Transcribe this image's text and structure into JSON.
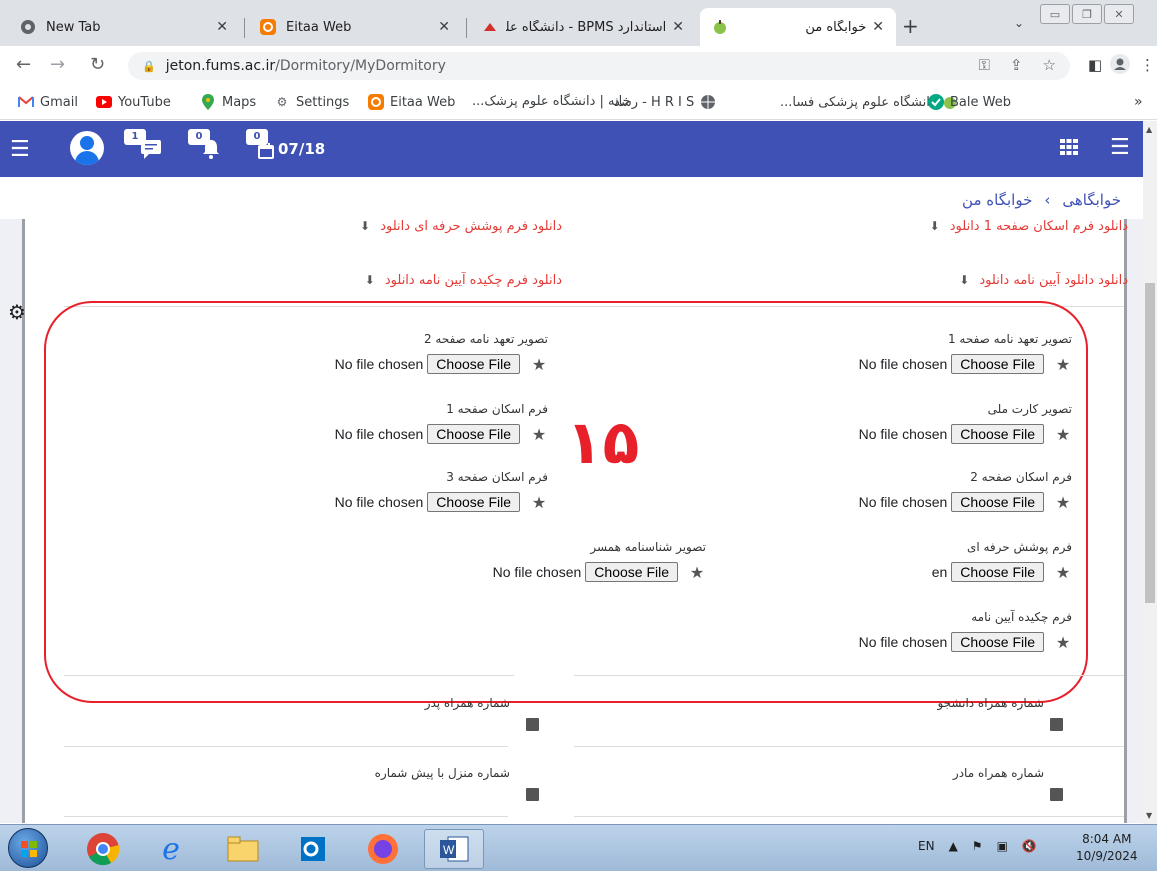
{
  "browser": {
    "tabs": [
      {
        "title": "New Tab",
        "favicon": "chrome-icon"
      },
      {
        "title": "Eitaa Web",
        "favicon": "eitaa-icon"
      },
      {
        "title": "استاندارد BPMS - دانشگاه علوم",
        "favicon": "bpms-icon"
      },
      {
        "title": "خوابگاه من",
        "favicon": "fums-icon",
        "active": true
      }
    ],
    "url_host": "jeton.fums.ac.ir",
    "url_path": "/Dormitory/MyDormitory",
    "bookmarks": [
      {
        "label": "Gmail",
        "icon": "gmail-icon"
      },
      {
        "label": "YouTube",
        "icon": "youtube-icon"
      },
      {
        "label": "Maps",
        "icon": "maps-icon"
      },
      {
        "label": "Settings",
        "icon": "gear-icon"
      },
      {
        "label": "Eitaa Web",
        "icon": "eitaa-icon"
      },
      {
        "label": "خانه | دانشگاه علوم پزشک...",
        "icon": "none"
      },
      {
        "label": "H R I S - رشد",
        "icon": "globe-icon"
      },
      {
        "label": "دانشگاه علوم پزشکی فسا...",
        "icon": "fums-icon"
      },
      {
        "label": "Bale Web",
        "icon": "bale-icon"
      }
    ]
  },
  "header": {
    "messages_badge": "1",
    "notifications_badge": "0",
    "calendar_badge": "0",
    "date": "07/18",
    "colors": {
      "bar": "#3f51b5"
    }
  },
  "breadcrumb": {
    "parent": "خوابگاهی",
    "current": "خوابگاه من",
    "separator": "›"
  },
  "downloads": {
    "top_right": "دانلود فرم اسکان صفحه 1",
    "top_left": "دانلود فرم پوشش حرفه ای",
    "mid_right": "دانلود دانلود آیین نامه",
    "mid_left": "دانلود فرم چکیده آیین نامه",
    "link_text": "دانلود"
  },
  "uploads": {
    "no_file_text": "No file chosen",
    "choose_label": "Choose File",
    "truncated_no_file": "en",
    "fields": {
      "pledge_page1": "تصویر تعهد نامه صفحه 1",
      "pledge_page2": "تصویر تعهد نامه صفحه 2",
      "national_card": "تصویر کارت ملی",
      "residence_page1": "فرم اسکان صفحه 1",
      "residence_page2": "فرم اسکان صفحه 2",
      "residence_page3": "فرم اسکان صفحه 3",
      "professional_cover": "فرم پوشش حرفه ای",
      "spouse_id": "تصویر شناسنامه همسر",
      "regulation_summary": "فرم چکیده آیین نامه"
    }
  },
  "annotation": {
    "number": "۱۵",
    "color": "#e8202a"
  },
  "contact_fields": {
    "student_mobile": "شماره همراه دانشجو",
    "father_mobile": "شماره همراه پدر",
    "mother_mobile": "شماره همراه مادر",
    "home_phone": "شماره منزل با پیش شماره"
  },
  "taskbar": {
    "lang": "EN",
    "time": "8:04 AM",
    "date": "10/9/2024"
  }
}
